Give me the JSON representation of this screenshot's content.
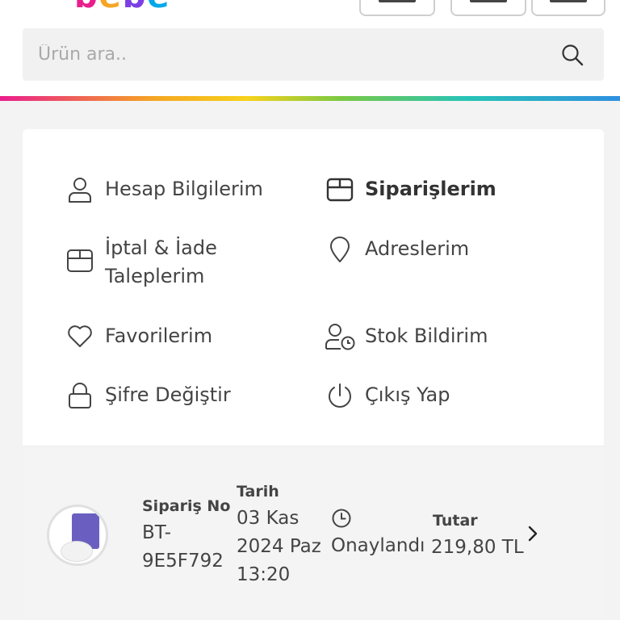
{
  "header": {
    "logo_text": [
      "b",
      "e",
      "b",
      "e"
    ]
  },
  "search": {
    "placeholder": "Ürün ara..",
    "value": "",
    "icon": "search-icon"
  },
  "menu": {
    "items": [
      {
        "label": "Hesap Bilgilerim",
        "icon": "user-icon"
      },
      {
        "label": "Siparişlerim",
        "icon": "box-icon",
        "active": true
      },
      {
        "label": "İptal & İade Taleplerim",
        "icon": "return-box-icon"
      },
      {
        "label": "Adreslerim",
        "icon": "location-pin-icon"
      },
      {
        "label": "Favorilerim",
        "icon": "heart-icon"
      },
      {
        "label": "Stok Bildirim",
        "icon": "user-clock-icon"
      },
      {
        "label": "Şifre Değiştir",
        "icon": "lock-icon"
      },
      {
        "label": "Çıkış Yap",
        "icon": "power-icon"
      }
    ]
  },
  "order": {
    "order_no_label": "Sipariş No",
    "order_no_line1": "BT-",
    "order_no_line2": "9E5F792",
    "date_label": "Tarih",
    "date_line1": "03 Kas",
    "date_line2": "2024 Paz",
    "date_line3": "13:20",
    "status": "Onaylandı",
    "status_icon": "clock-icon",
    "total_label": "Tutar",
    "total_value": "219,80 TL"
  },
  "colors": {
    "accent_text": "#333333",
    "card_bg": "#ffffff",
    "page_bg": "#f3f3f3"
  }
}
